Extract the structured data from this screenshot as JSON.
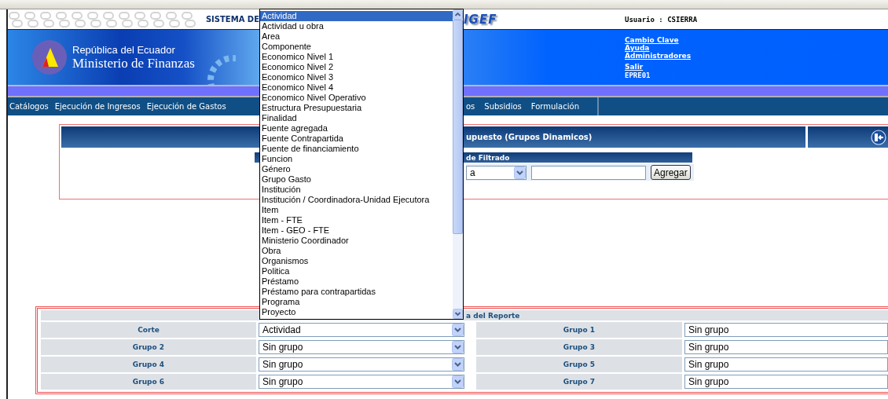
{
  "header": {
    "system_title": "SISTEMA DE",
    "logo_text": "IGEF",
    "user": "Usuario : CSIERRA"
  },
  "banner": {
    "country": "República del Ecuador",
    "ministry": "Ministerio de Finanzas",
    "links": [
      "Cambio Clave",
      "Ayuda",
      "Administradores",
      "Salir"
    ],
    "code": "EPRE01"
  },
  "nav": {
    "left": [
      "Catálogos",
      "Ejecución de Ingresos",
      "Ejecución de Gastos"
    ],
    "right": [
      "os",
      "Subsidios",
      "Formulación"
    ]
  },
  "panel": {
    "title": "upuesto (Grupos Dinamicos)",
    "filter": {
      "title": "de Filtrado",
      "select_value": "a",
      "button": "Agregar"
    }
  },
  "report": {
    "title": "a del Reporte",
    "rows": [
      {
        "left_label": "Corte",
        "left_value": "Actividad",
        "right_label": "Grupo 1",
        "right_value": "Sin grupo"
      },
      {
        "left_label": "Grupo 2",
        "left_value": "Sin grupo",
        "right_label": "Grupo 3",
        "right_value": "Sin grupo"
      },
      {
        "left_label": "Grupo 4",
        "left_value": "Sin grupo",
        "right_label": "Grupo 5",
        "right_value": "Sin grupo"
      },
      {
        "left_label": "Grupo 6",
        "left_value": "Sin grupo",
        "right_label": "Grupo 7",
        "right_value": "Sin grupo"
      }
    ]
  },
  "dropdown": {
    "options": [
      {
        "label": "Actividad",
        "selected": true
      },
      {
        "label": "Actividad u obra",
        "selected": false
      },
      {
        "label": "Area",
        "selected": false
      },
      {
        "label": "Componente",
        "selected": false
      },
      {
        "label": "Economico Nivel 1",
        "selected": false
      },
      {
        "label": "Economico Nivel 2",
        "selected": false
      },
      {
        "label": "Economico Nivel 3",
        "selected": false
      },
      {
        "label": "Economico Nivel 4",
        "selected": false
      },
      {
        "label": "Economico Nivel Operativo",
        "selected": false
      },
      {
        "label": "Estructura Presupuestaria",
        "selected": false
      },
      {
        "label": "Finalidad",
        "selected": false
      },
      {
        "label": "Fuente agregada",
        "selected": false
      },
      {
        "label": "Fuente Contrapartida",
        "selected": false
      },
      {
        "label": "Fuente de financiamiento",
        "selected": false
      },
      {
        "label": "Funcion",
        "selected": false
      },
      {
        "label": "Género",
        "selected": false
      },
      {
        "label": "Grupo Gasto",
        "selected": false
      },
      {
        "label": "Institución",
        "selected": false
      },
      {
        "label": "Institución / Coordinadora-Unidad Ejecutora",
        "selected": false
      },
      {
        "label": "Item",
        "selected": false
      },
      {
        "label": "Item - FTE",
        "selected": false
      },
      {
        "label": "Item - GEO - FTE",
        "selected": false
      },
      {
        "label": "Ministerio Coordinador",
        "selected": false
      },
      {
        "label": "Obra",
        "selected": false
      },
      {
        "label": "Organismos",
        "selected": false
      },
      {
        "label": "Politica",
        "selected": false
      },
      {
        "label": "Préstamo",
        "selected": false
      },
      {
        "label": "Préstamo para contrapartidas",
        "selected": false
      },
      {
        "label": "Programa",
        "selected": false
      },
      {
        "label": "Proyecto",
        "selected": false
      }
    ]
  }
}
